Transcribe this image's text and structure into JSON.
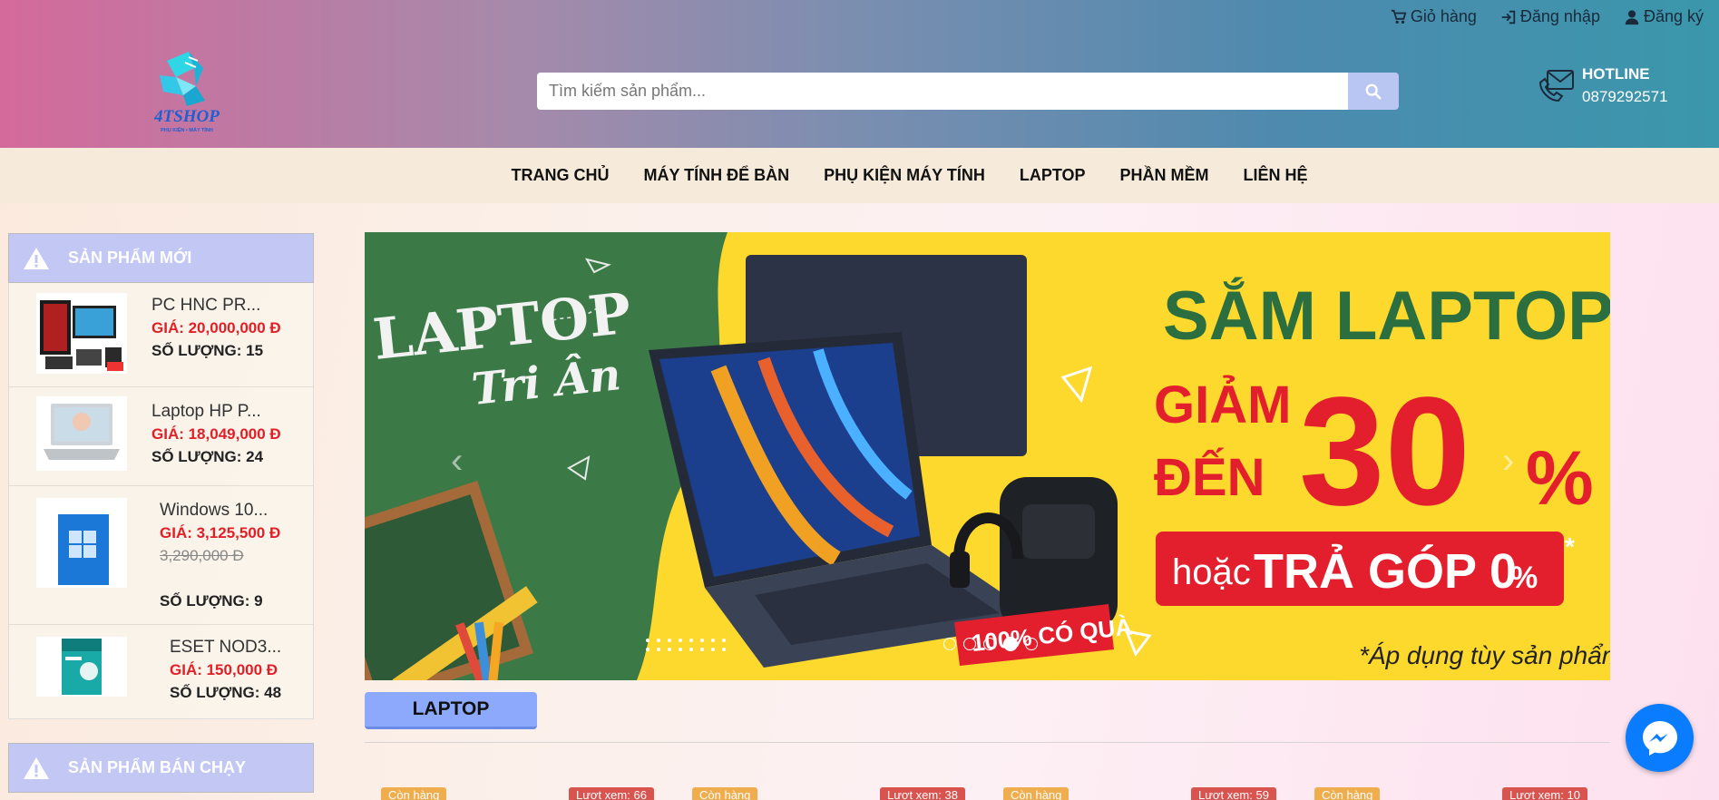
{
  "header": {
    "cart_label": "Giỏ hàng",
    "login_label": "Đăng nhập",
    "register_label": "Đăng ký",
    "logo_text": "4TSHOP",
    "logo_tagline": "PHỤ KIỆN • MÁY TÍNH",
    "search_placeholder": "Tìm kiếm sản phẩm...",
    "hotline_title": "HOTLINE",
    "hotline_number": "0879292571"
  },
  "nav": {
    "items": [
      "TRANG CHỦ",
      "MÁY TÍNH ĐỂ BÀN",
      "PHỤ KIỆN MÁY TÍNH",
      "LAPTOP",
      "PHẦN MỀM",
      "LIÊN HỆ"
    ]
  },
  "sidebar": {
    "new_title": "SẢN PHẨM MỚI",
    "best_title": "SẢN PHẨM BÁN CHẠY",
    "products": [
      {
        "name": "PC HNC PR...",
        "price": "GIÁ: 20,000,000 Đ",
        "qty": "SỐ LƯỢNG: 15"
      },
      {
        "name": "Laptop HP P...",
        "price": "GIÁ: 18,049,000 Đ",
        "qty": "SỐ LƯỢNG: 24"
      },
      {
        "name": "Windows 10...",
        "price": "GIÁ: 3,125,500 Đ",
        "old_price": "3,290,000 Đ",
        "qty": "SỐ LƯỢNG: 9"
      },
      {
        "name": "ESET NOD3...",
        "price": "GIÁ: 150,000 Đ",
        "qty": "SỐ LƯỢNG: 48"
      }
    ]
  },
  "banner": {
    "script_line1": "LAPTOP",
    "script_line2": "Tri Ân",
    "headline": "SẮM LAPTOP",
    "giam": "GIẢM",
    "den": "ĐẾN",
    "percent": "30",
    "percent_sign": "%",
    "hoac": "hoặc",
    "tra_gop": "TRẢ GÓP 0",
    "tra_gop_sign": "%",
    "star": "*",
    "gift": "100% CÓ QUÀ",
    "note": "*Áp dụng tùy sản phẩm",
    "slide_count": 5,
    "active_slide": 4
  },
  "section": {
    "title": "LAPTOP",
    "badges": [
      "Còn hàng",
      "Lượt xem: 66",
      "Còn hàng",
      "Lượt xem: 38",
      "Còn hàng",
      "Lượt xem: 59",
      "Còn hàng",
      "Lượt xem: 10"
    ]
  },
  "colors": {
    "accent_blue": "#8ca9fb",
    "price_red": "#e21f27",
    "banner_yellow": "#fcd92c",
    "banner_green": "#3c7a4a",
    "messenger_blue": "#0a7cff"
  }
}
